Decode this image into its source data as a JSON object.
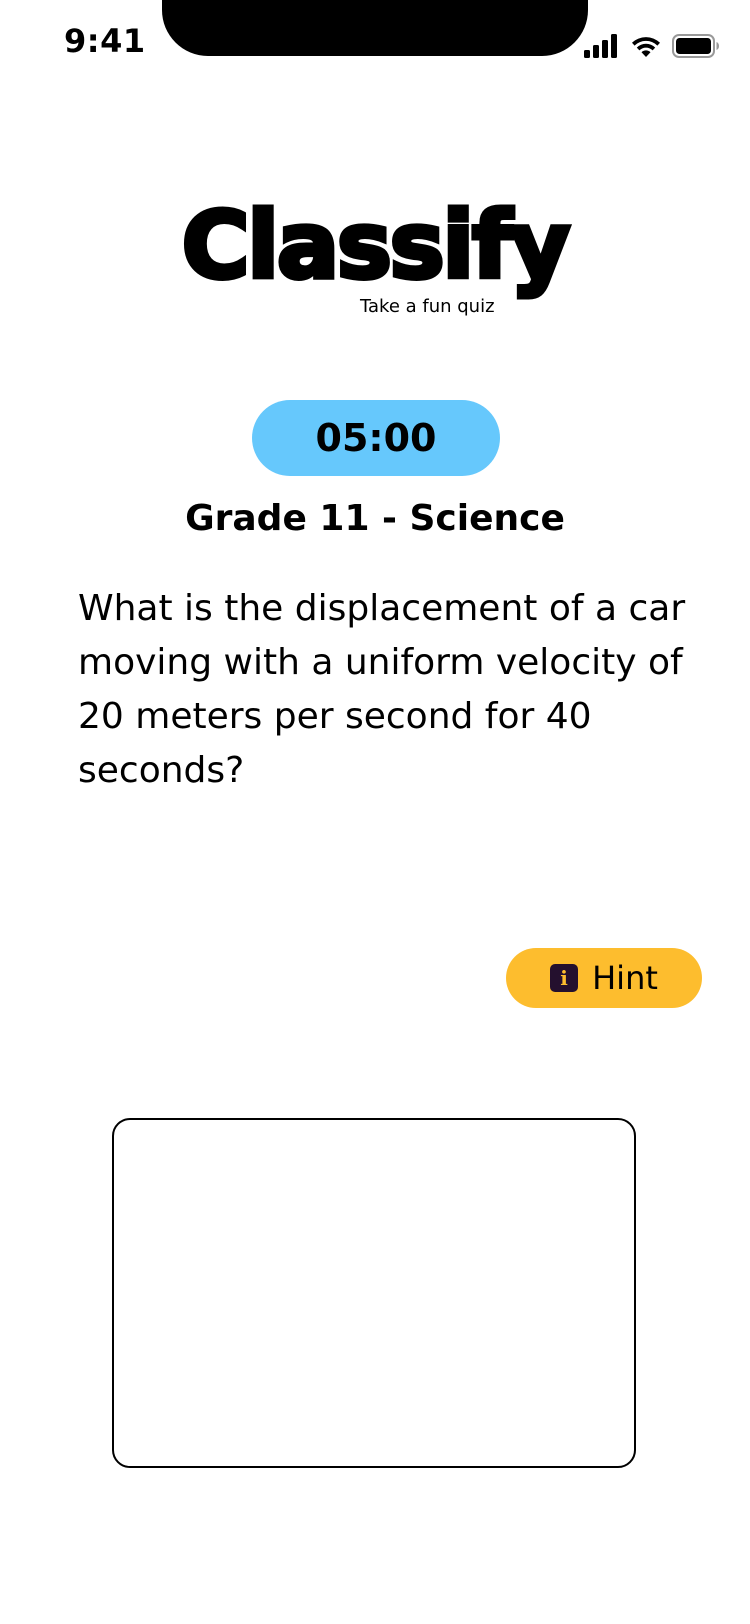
{
  "status_bar": {
    "time": "9:41"
  },
  "logo": {
    "title": "Classify",
    "subtitle": "Take a fun quiz"
  },
  "timer": {
    "value": "05:00",
    "color": "#66c8fc"
  },
  "quiz": {
    "subject": "Grade 11 - Science",
    "question": "What is the displacement of a car moving with a uniform velocity of 20 meters per second for 40 seconds?"
  },
  "hint": {
    "label": "Hint",
    "icon": "info-icon",
    "color": "#fdbd2e"
  },
  "answer": {
    "value": "",
    "placeholder": ""
  }
}
